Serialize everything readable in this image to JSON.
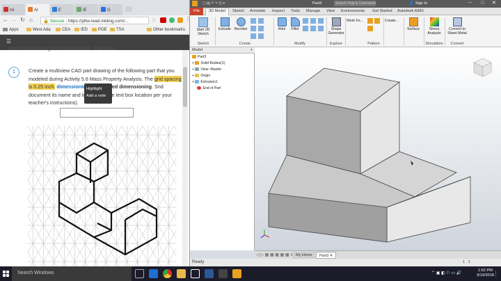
{
  "browser": {
    "tabs": [
      {
        "label": "mi",
        "color": "#c33"
      },
      {
        "label": "Ar",
        "color": "#e57c2b"
      },
      {
        "label": "E",
        "color": "#2b7de0"
      },
      {
        "label": "IE",
        "color": "#6a6"
      },
      {
        "label": "G",
        "color": "#2b6fe0"
      }
    ],
    "url": "https://pltw.read.inkling.com/...",
    "secure_label": "Secure",
    "bookmarks": [
      "Apps",
      "West Ada",
      "CEA",
      "IED",
      "POE",
      "TSA"
    ],
    "other_bookmarks": "Other bookmarks"
  },
  "reader": {
    "cut_title": "More Dimensioning Part Pictorial.docx, if desired.",
    "activity_number": "1",
    "p1": "Create a multiview CAD part drawing of the following part that you modeled during Activity 5.6 Mass Property Analysis. The ",
    "p_hl": "grid spacing is 0.25 inch.",
    "p2": " ",
    "p_blue": "dimensioning",
    "p3": " and ",
    "p_bold": "aligned dimensioning",
    "p4": ". S",
    "p5": "nd document its name and location (in the text box ",
    "p6": " location per your teacher's instructions).",
    "popup_highlight": "Highlight",
    "popup_note": "Add a note"
  },
  "inventor": {
    "title_file": "Part3",
    "search_placeholder": "Search Help & Commands...",
    "sign_in": "Sign In",
    "tabs": [
      "File",
      "3D Model",
      "Sketch",
      "Annotate",
      "Inspect",
      "Tools",
      "Manage",
      "View",
      "Environments",
      "Get Started",
      "Autodesk A360"
    ],
    "buttons": {
      "start_sketch": "Start 2D Sketch",
      "extrude": "Extrude",
      "revolve": "Revolve",
      "hole": "Hole",
      "fillet": "Fillet",
      "shape_generator": "Shape Generator",
      "work_features": "Work Fe...",
      "create": "Create...",
      "surface": "Surface",
      "stress": "Stress Analysis",
      "convert": "Convert to Sheet Metal"
    },
    "groups": [
      "Sketch",
      "Create",
      "Modify",
      "Explore",
      "Pattern",
      "Simulation",
      "Convert"
    ],
    "model_panel": "Model",
    "tree": [
      "Part3",
      "Solid Bodies(1)",
      "View: Master",
      "Origin",
      "Extrusion1",
      "End of Part"
    ],
    "bottom_tabs": [
      "My Home",
      "Part3"
    ],
    "status": "Ready"
  },
  "taskbar": {
    "search": "Search Windows",
    "time": "1:52 PM",
    "date": "3/19/2018"
  }
}
